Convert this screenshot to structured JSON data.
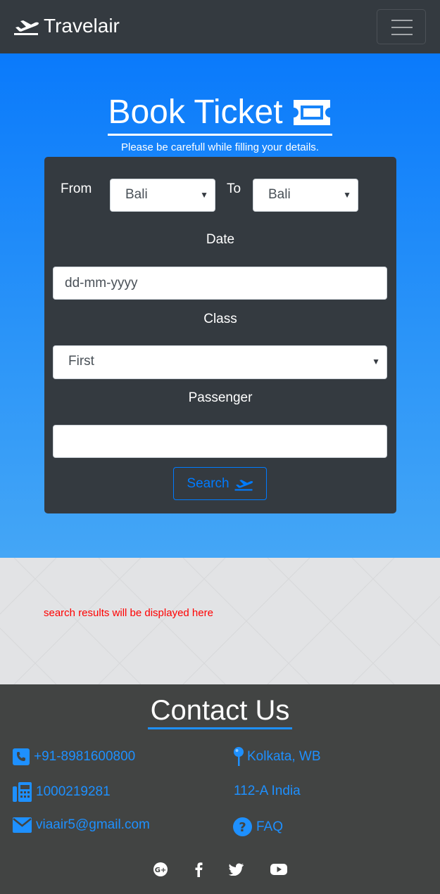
{
  "navbar": {
    "brand": "Travelair",
    "menu_icon": "hamburger-icon"
  },
  "hero": {
    "title": "Book Ticket",
    "title_icon": "ticket-icon",
    "subtitle": "Please be carefull while filling your details."
  },
  "form": {
    "from_label": "From",
    "from_value": "Bali",
    "to_label": "To",
    "to_value": "Bali",
    "date_label": "Date",
    "date_placeholder": "dd-mm-yyyy",
    "class_label": "Class",
    "class_value": "First",
    "passenger_label": "Passenger",
    "passenger_value": "",
    "search_label": "Search",
    "search_icon": "plane-departure-icon"
  },
  "results": {
    "message": "search results will be displayed here"
  },
  "contact": {
    "title": "Contact Us",
    "phone": "+91-8981600800",
    "fax": "1000219281",
    "email": "viaair5@gmail.com",
    "location": "Kolkata, WB",
    "address": "112-A India",
    "faq": "FAQ",
    "social": [
      "google-plus-icon",
      "facebook-icon",
      "twitter-icon",
      "youtube-icon"
    ]
  },
  "colors": {
    "navbar": "#343a40",
    "hero_top": "#0a7afb",
    "hero_bottom": "#44a6f6",
    "card": "#343a40",
    "accent": "#007bff",
    "footer": "#424443",
    "footer_link": "#1e90ff",
    "result_text": "#ff0000"
  }
}
